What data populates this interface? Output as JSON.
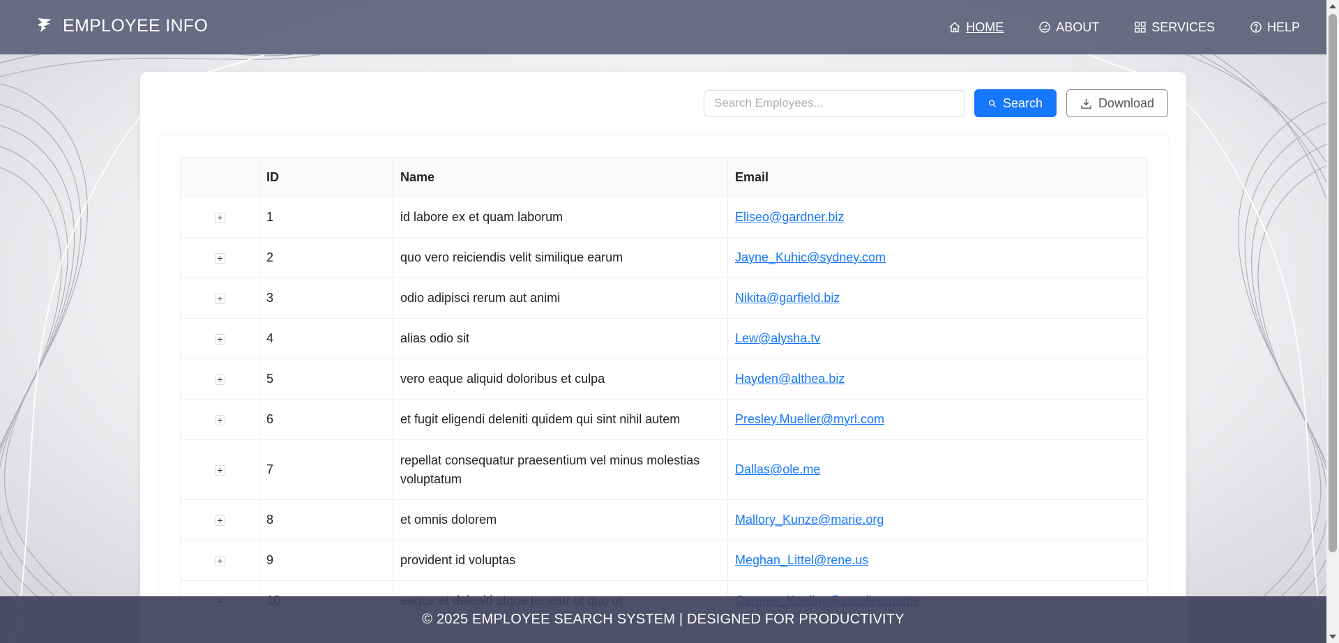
{
  "header": {
    "title": "EMPLOYEE INFO",
    "nav": [
      {
        "label": "HOME",
        "icon": "home-icon",
        "active": true
      },
      {
        "label": "ABOUT",
        "icon": "dashboard-icon",
        "active": false
      },
      {
        "label": "SERVICES",
        "icon": "grid-icon",
        "active": false
      },
      {
        "label": "HELP",
        "icon": "question-circle-icon",
        "active": false
      }
    ]
  },
  "toolbar": {
    "search_placeholder": "Search Employees...",
    "search_value": "",
    "search_label": "Search",
    "download_label": "Download"
  },
  "table": {
    "columns": [
      "",
      "ID",
      "Name",
      "Email"
    ],
    "rows": [
      {
        "id": "1",
        "name": "id labore ex et quam laborum",
        "email": "Eliseo@gardner.biz"
      },
      {
        "id": "2",
        "name": "quo vero reiciendis velit similique earum",
        "email": "Jayne_Kuhic@sydney.com"
      },
      {
        "id": "3",
        "name": "odio adipisci rerum aut animi",
        "email": "Nikita@garfield.biz"
      },
      {
        "id": "4",
        "name": "alias odio sit",
        "email": "Lew@alysha.tv"
      },
      {
        "id": "5",
        "name": "vero eaque aliquid doloribus et culpa",
        "email": "Hayden@althea.biz"
      },
      {
        "id": "6",
        "name": "et fugit eligendi deleniti quidem qui sint nihil autem",
        "email": "Presley.Mueller@myrl.com"
      },
      {
        "id": "7",
        "name": "repellat consequatur praesentium vel minus molestias voluptatum",
        "email": "Dallas@ole.me"
      },
      {
        "id": "8",
        "name": "et omnis dolorem",
        "email": "Mallory_Kunze@marie.org"
      },
      {
        "id": "9",
        "name": "provident id voluptas",
        "email": "Meghan_Littel@rene.us"
      },
      {
        "id": "10",
        "name": "eaque et deleniti atque tenetur ut quo ut",
        "email": "Carmen_Keeling@caroline.name"
      }
    ]
  },
  "footer": {
    "text": "© 2025 EMPLOYEE SEARCH SYSTEM | DESIGNED FOR PRODUCTIVITY"
  },
  "colors": {
    "header_bg": "#5f5f7a",
    "footer_bg": "#40405c",
    "primary": "#1677ff",
    "link": "#1677ff"
  }
}
